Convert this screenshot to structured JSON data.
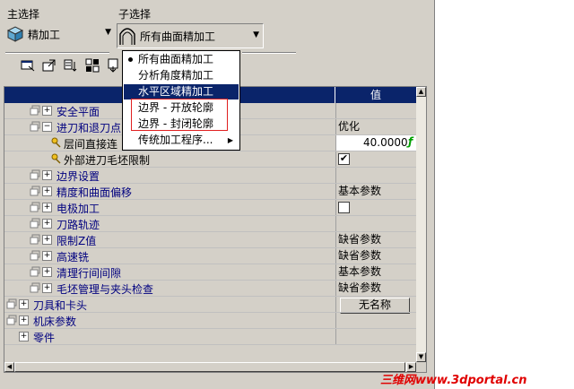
{
  "header": {
    "main_label": "主选择",
    "sub_label": "子选择",
    "main_combo_value": "精加工",
    "sub_combo_value": "所有曲面精加工"
  },
  "toolbar": {
    "icons": [
      "pointer-window-icon",
      "export-icon",
      "sort-icon",
      "layout-icon",
      "move-down-icon"
    ]
  },
  "menu": {
    "items": [
      {
        "label": "所有曲面精加工",
        "checked": true
      },
      {
        "label": "分析角度精加工"
      },
      {
        "label": "水平区域精加工",
        "selected": true
      },
      {
        "label": "边界 - 开放轮廓"
      },
      {
        "label": "边界 - 封闭轮廓"
      },
      {
        "label": "传统加工程序...",
        "submenu": true
      }
    ]
  },
  "tree": {
    "value_header": "值",
    "rows": [
      {
        "label": "安全平面",
        "value": ""
      },
      {
        "label": "进刀和退刀点",
        "value": "优化"
      },
      {
        "label": "层间直接连",
        "value": "40.0000"
      },
      {
        "label": "外部进刀毛坯限制",
        "checked": true
      },
      {
        "label": "边界设置",
        "value": ""
      },
      {
        "label": "精度和曲面偏移",
        "value": "基本参数"
      },
      {
        "label": "电极加工",
        "checked": false
      },
      {
        "label": "刀路轨迹",
        "value": ""
      },
      {
        "label": "限制Z值",
        "value": "缺省参数"
      },
      {
        "label": "高速铣",
        "value": "缺省参数"
      },
      {
        "label": "清理行间间隙",
        "value": "基本参数"
      },
      {
        "label": "毛坯管理与夹头检查",
        "value": "缺省参数"
      },
      {
        "label": "刀具和卡头",
        "value": "无名称"
      },
      {
        "label": "机床参数",
        "value": ""
      },
      {
        "label": "零件",
        "value": ""
      }
    ]
  },
  "watermark": "三维网www.3dportal.cn",
  "colors": {
    "selection": "#0a246a",
    "highlight_box": "#e02020",
    "watermark": "#e00000"
  }
}
